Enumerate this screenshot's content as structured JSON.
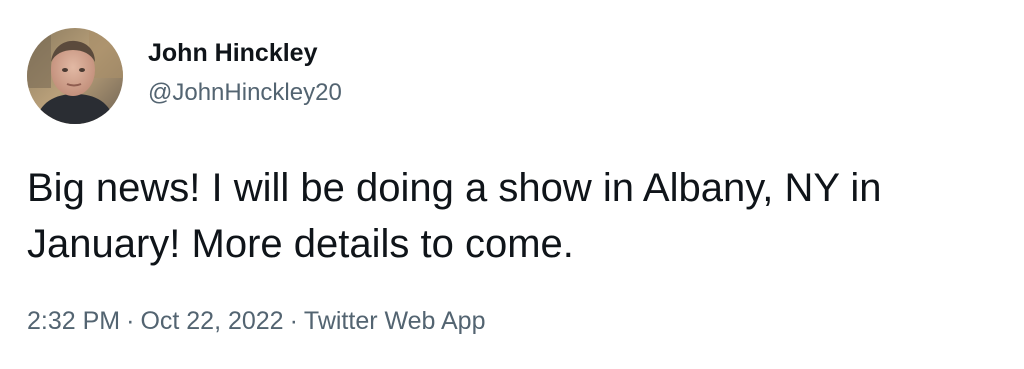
{
  "tweet": {
    "author": {
      "display_name": "John Hinckley",
      "handle": "@JohnHinckley20"
    },
    "text": "Big news! I will be doing a show in Albany, NY in January! More details to come.",
    "meta": {
      "time": "2:32 PM",
      "date": "Oct 22, 2022",
      "source": "Twitter Web App",
      "separator": "·"
    }
  },
  "colors": {
    "text_primary": "#0f1419",
    "text_secondary": "#536471",
    "background": "#ffffff"
  }
}
